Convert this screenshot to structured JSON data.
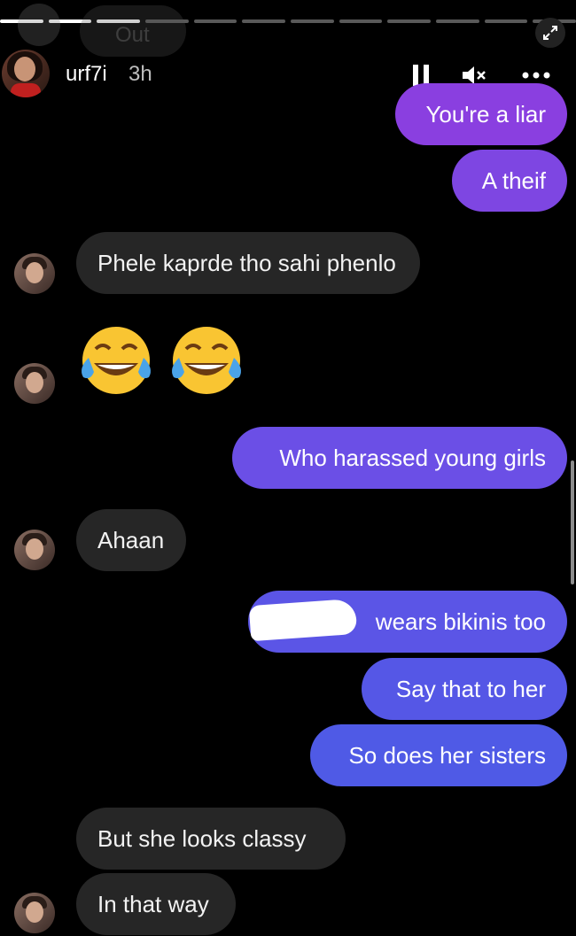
{
  "header": {
    "ghost_text": "Out",
    "username": "urf7i",
    "time": "3h",
    "progress_segments": 12,
    "progress_done": 3
  },
  "icons": {
    "pause": "pause-icon",
    "mute": "mute-icon",
    "more": "more-icon",
    "expand": "expand-icon"
  },
  "messages": {
    "m1": "You're a liar",
    "m2": "A theif",
    "m3": "Phele kaprde tho sahi phenlo",
    "m4_emoji": "😂😂",
    "m5": "Who harassed young girls",
    "m6": "Ahaan",
    "m7": "wears bikinis too",
    "m8": "Say that to her",
    "m9": "So does her sisters",
    "m10": "But she looks classy",
    "m11": "In that way"
  },
  "colors": {
    "sent_top": "#8a3fe0",
    "sent_mid": "#6b4fe6",
    "sent_bottom": "#4f5ae6",
    "received": "#262626",
    "background": "#000000"
  }
}
